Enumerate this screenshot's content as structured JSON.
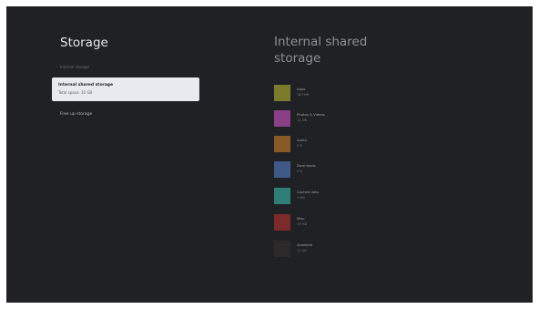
{
  "left": {
    "title": "Storage",
    "section_label": "Internal storage",
    "selected_item": {
      "name": "Internal shared storage",
      "detail": "Total space: 32 GB"
    },
    "free_up_label": "Free up storage"
  },
  "right": {
    "title": "Internal shared storage",
    "categories": [
      {
        "icon": "apps-icon",
        "name": "Apps",
        "size": "183 MB",
        "color": "#7c7a2b"
      },
      {
        "icon": "photos-videos-icon",
        "name": "Photos & Videos",
        "size": "11 MB",
        "color": "#8b3f86"
      },
      {
        "icon": "audio-icon",
        "name": "Audio",
        "size": "0 B",
        "color": "#8a5a26"
      },
      {
        "icon": "downloads-icon",
        "name": "Downloads",
        "size": "0 B",
        "color": "#3f5a86"
      },
      {
        "icon": "cached-data-icon",
        "name": "Cached data",
        "size": "1 MB",
        "color": "#2f7f77"
      },
      {
        "icon": "misc-icon",
        "name": "Misc.",
        "size": "19 MB",
        "color": "#7d2a2a"
      },
      {
        "icon": "available-icon",
        "name": "Available",
        "size": "11 GB",
        "color": "#2c2a29"
      }
    ]
  }
}
